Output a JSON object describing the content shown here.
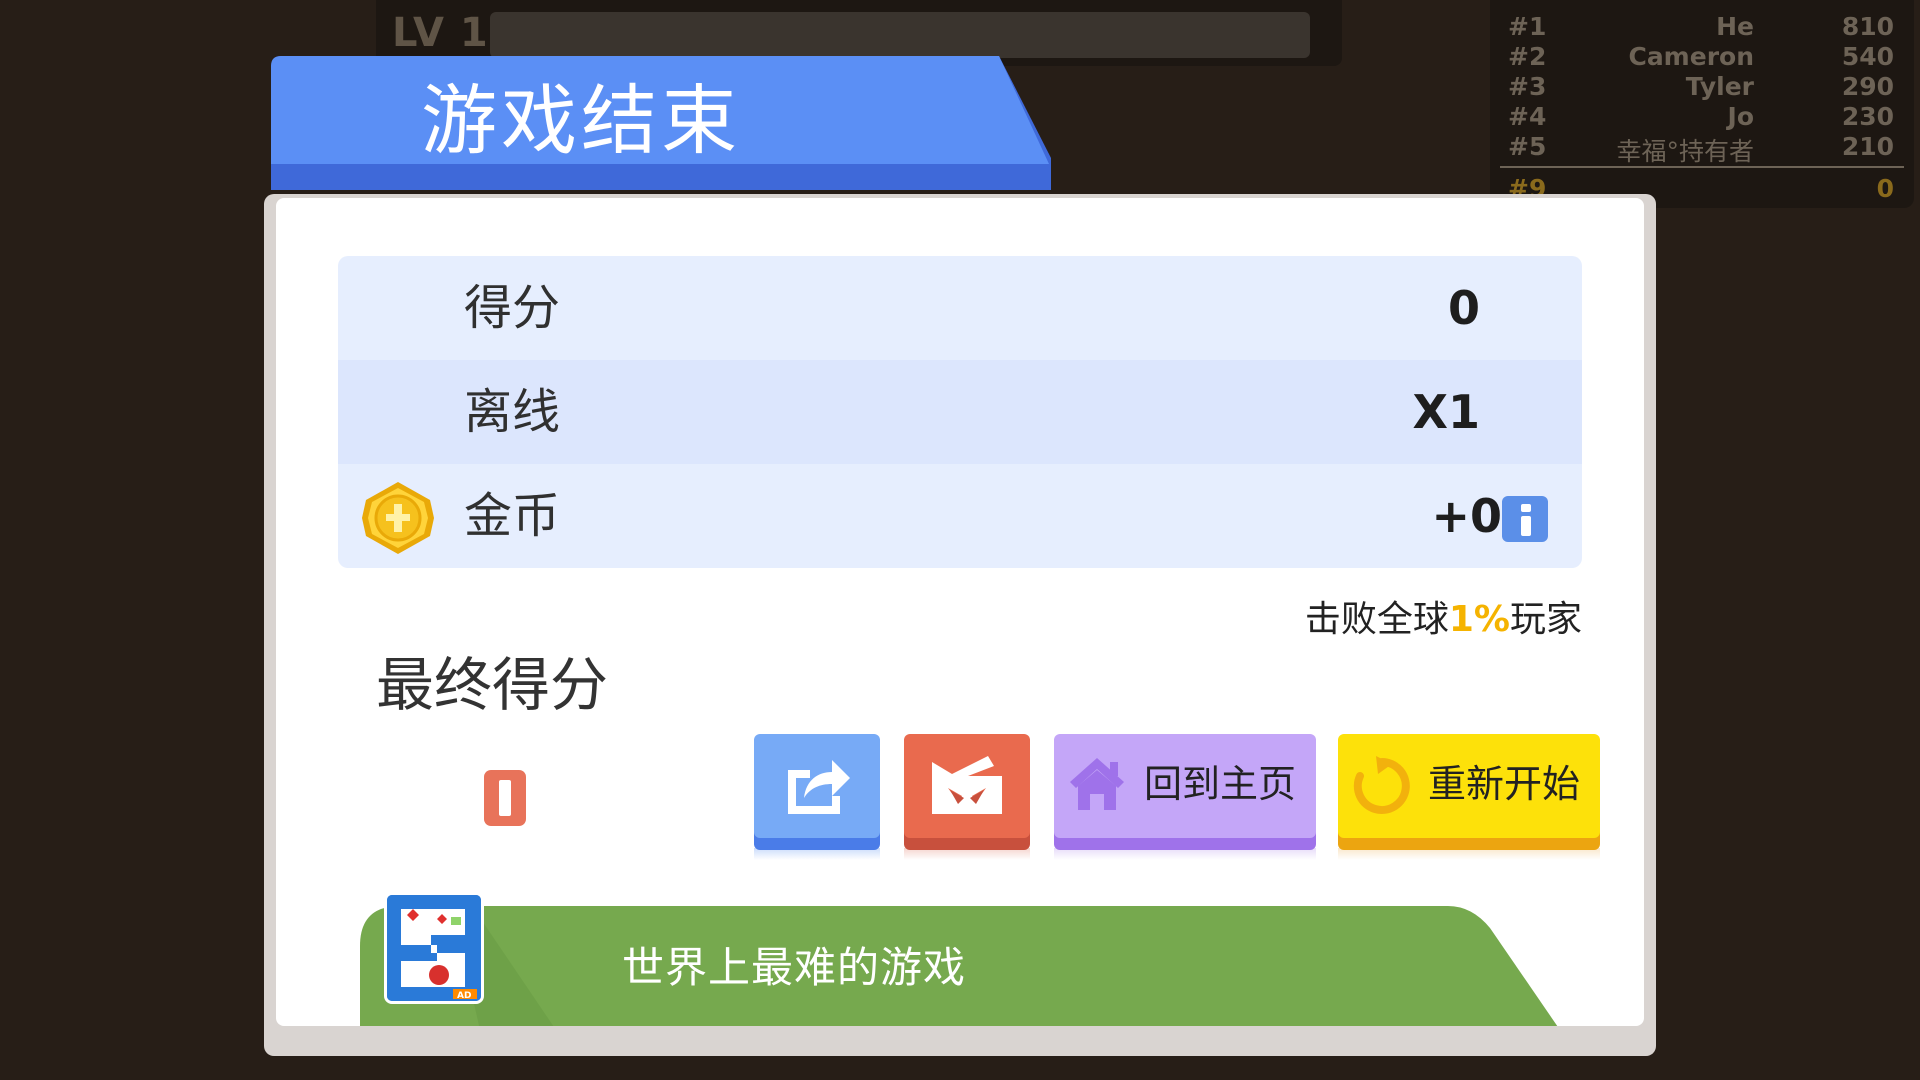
{
  "hud": {
    "level_label": "LV 1",
    "xp_progress": 0
  },
  "leaderboard": {
    "rows": [
      {
        "rank": "#1",
        "name": "He",
        "score": "810"
      },
      {
        "rank": "#2",
        "name": "Cameron",
        "score": "540"
      },
      {
        "rank": "#3",
        "name": "Tyler",
        "score": "290"
      },
      {
        "rank": "#4",
        "name": "Jo",
        "score": "230"
      },
      {
        "rank": "#5",
        "name": "幸福°持有者",
        "score": "210"
      }
    ],
    "self": {
      "rank": "#9",
      "score": "0"
    }
  },
  "dialog": {
    "title": "游戏结束",
    "stats": [
      {
        "label": "得分",
        "value": "0"
      },
      {
        "label": "离线",
        "value": "X1"
      },
      {
        "label": "金币",
        "value": "+0"
      }
    ],
    "defeat_prefix": "击败全球",
    "defeat_percent": "1%",
    "defeat_suffix": "玩家",
    "final_label": "最终得分",
    "final_value": "0",
    "buttons": {
      "share_icon": "share-icon",
      "video_icon": "video-reward-icon",
      "home": "回到主页",
      "restart": "重新开始"
    },
    "ad_text": "世界上最难的游戏",
    "ad_badge": "AD"
  },
  "colors": {
    "banner_blue": "#5b8ff5",
    "stat_row_light": "#e6eefe",
    "stat_row_mid": "#dce6fd",
    "ad_green": "#76a94e",
    "percent_gold": "#f5b300"
  }
}
